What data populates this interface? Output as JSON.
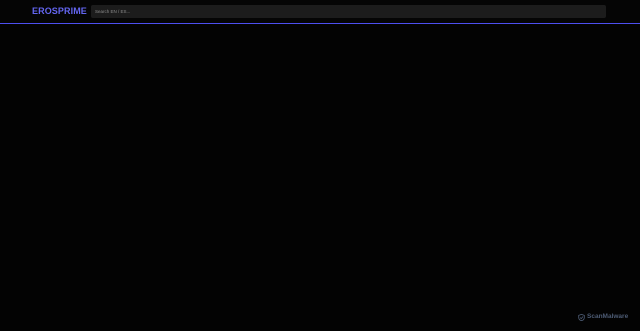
{
  "header": {
    "logo_text": "EROSPRIME",
    "search_placeholder": "Search EN / ES..."
  },
  "watermark": {
    "icon": "scanmalware-shield-icon",
    "text": "ScanMalware"
  },
  "colors": {
    "background": "#030303",
    "accent": "#6466f1",
    "header_border": "#4d4ff0",
    "search_bg": "#1c1c1c"
  }
}
